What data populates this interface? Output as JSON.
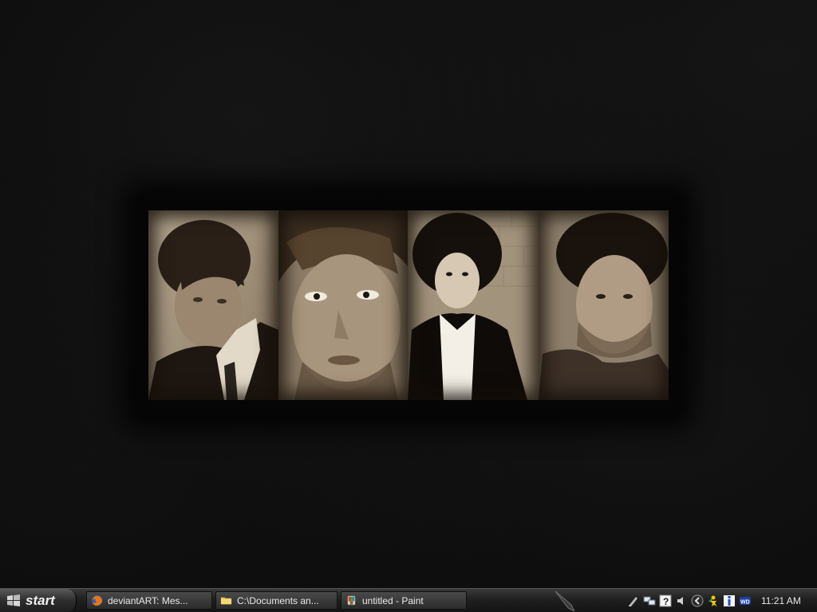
{
  "desktop": {
    "background": "dark grunge wallpaper",
    "collage": {
      "photos": [
        {
          "icon": "portrait-photo-1",
          "tone": "#a08e78"
        },
        {
          "icon": "portrait-photo-2",
          "tone": "#9a8a76"
        },
        {
          "icon": "portrait-photo-3",
          "tone": "#b8ab98"
        },
        {
          "icon": "portrait-photo-4",
          "tone": "#958670"
        }
      ]
    }
  },
  "taskbar": {
    "start_label": "start",
    "tasks": [
      {
        "label": "deviantART: Mes...",
        "icon": "firefox-icon"
      },
      {
        "label": "C:\\Documents an...",
        "icon": "folder-icon"
      },
      {
        "label": "untitled - Paint",
        "icon": "paint-icon"
      }
    ],
    "tray": {
      "icons": [
        "pen-icon",
        "network-icon",
        "help-icon",
        "volume-icon",
        "expand-arrow-icon",
        "messenger-icon",
        "info-icon",
        "wd-icon"
      ],
      "clock": "11:21 AM"
    }
  },
  "colors": {
    "taskbar": "#202020",
    "desktop": "#0b0b0b",
    "sepia": "#a08e78"
  }
}
